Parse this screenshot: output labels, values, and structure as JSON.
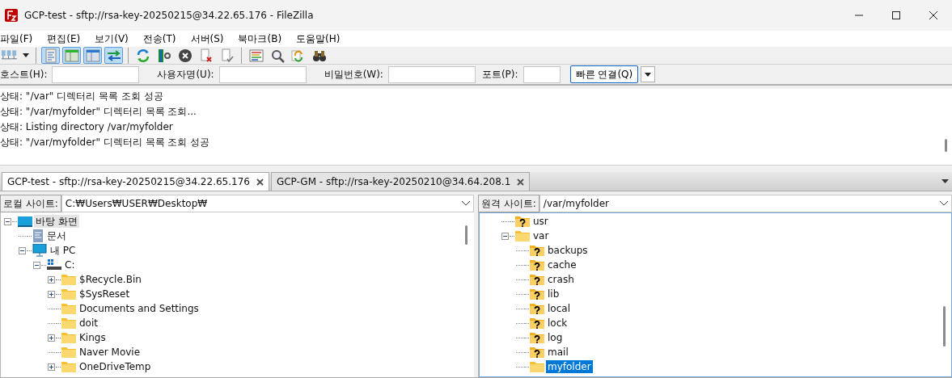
{
  "window": {
    "title": "GCP-test - sftp://rsa-key-20250215@34.22.65.176 - FileZilla"
  },
  "menu": [
    "파일(F)",
    "편집(E)",
    "보기(V)",
    "전송(T)",
    "서버(S)",
    "북마크(B)",
    "도움말(H)"
  ],
  "toolbar": [
    [
      {
        "kind": "sites",
        "on": false,
        "menu": true
      }
    ],
    [
      {
        "kind": "log",
        "on": true
      },
      {
        "kind": "localtree",
        "on": true
      },
      {
        "kind": "remotetree",
        "on": true
      },
      {
        "kind": "queue",
        "on": true
      }
    ],
    [
      {
        "kind": "refresh",
        "on": false
      },
      {
        "kind": "filter",
        "on": false
      },
      {
        "kind": "cancel",
        "on": false
      },
      {
        "kind": "disconnect",
        "on": false
      },
      {
        "kind": "reconnect",
        "on": false
      }
    ],
    [
      {
        "kind": "list",
        "on": false
      },
      {
        "kind": "search",
        "on": false
      },
      {
        "kind": "sync",
        "on": false
      },
      {
        "kind": "binoculars",
        "on": false
      }
    ]
  ],
  "quickconnect": {
    "fields": [
      {
        "label": "호스트(H):"
      },
      {
        "label": "사용자명(U):"
      },
      {
        "label": "비밀번호(W):"
      },
      {
        "label": "포트(P):"
      }
    ],
    "button": "빠른 연결(Q)"
  },
  "log": [
    "상태: \"/var\" 디렉터리 목록 조회 성공",
    "상태: \"/var/myfolder\" 디렉터리 목록 조회...",
    "상태: Listing directory /var/myfolder",
    "상태: \"/var/myfolder\" 디렉터리 목록 조회 성공"
  ],
  "tabs": [
    {
      "label": "GCP-test - sftp://rsa-key-20250215@34.22.65.176",
      "selected": true
    },
    {
      "label": "GCP-GM - sftp://rsa-key-20250210@34.64.208.1",
      "selected": false
    }
  ],
  "local": {
    "label": "로컬 사이트:",
    "path": "C:₩Users₩USER₩Desktop₩",
    "focused": false,
    "tree": [
      {
        "label": "바탕 화면",
        "kind": "desktop",
        "selected": true,
        "expanded": true,
        "children": [
          {
            "label": "문서",
            "kind": "document",
            "selected": false
          },
          {
            "label": "내 PC",
            "kind": "computer",
            "selected": false,
            "expanded": true,
            "children": [
              {
                "label": "C:",
                "kind": "drive",
                "selected": false,
                "expanded": true,
                "children": [
                  {
                    "label": "$Recycle.Bin",
                    "kind": "folder",
                    "selected": false,
                    "expanded": false
                  },
                  {
                    "label": "$SysReset",
                    "kind": "folder",
                    "selected": false,
                    "expanded": false
                  },
                  {
                    "label": "Documents and Settings",
                    "kind": "folder",
                    "selected": false
                  },
                  {
                    "label": "doit",
                    "kind": "folder",
                    "selected": false
                  },
                  {
                    "label": "Kings",
                    "kind": "folder",
                    "selected": false,
                    "expanded": false
                  },
                  {
                    "label": "Naver Movie",
                    "kind": "folder",
                    "selected": false
                  },
                  {
                    "label": "OneDriveTemp",
                    "kind": "folder",
                    "selected": false,
                    "expanded": false
                  }
                ]
              }
            ]
          }
        ]
      }
    ]
  },
  "remote": {
    "label": "원격 사이트:",
    "path": "/var/myfolder",
    "focused": true,
    "tree": [
      {
        "label": "usr",
        "kind": "unknown",
        "selected": false
      },
      {
        "label": "var",
        "kind": "folder",
        "selected": false,
        "expanded": true,
        "children": [
          {
            "label": "backups",
            "kind": "unknown",
            "selected": false
          },
          {
            "label": "cache",
            "kind": "unknown",
            "selected": false
          },
          {
            "label": "crash",
            "kind": "unknown",
            "selected": false
          },
          {
            "label": "lib",
            "kind": "unknown",
            "selected": false
          },
          {
            "label": "local",
            "kind": "unknown",
            "selected": false
          },
          {
            "label": "lock",
            "kind": "unknown",
            "selected": false
          },
          {
            "label": "log",
            "kind": "unknown",
            "selected": false
          },
          {
            "label": "mail",
            "kind": "unknown",
            "selected": false
          },
          {
            "label": "myfolder",
            "kind": "folder",
            "selected": true
          }
        ]
      }
    ]
  }
}
